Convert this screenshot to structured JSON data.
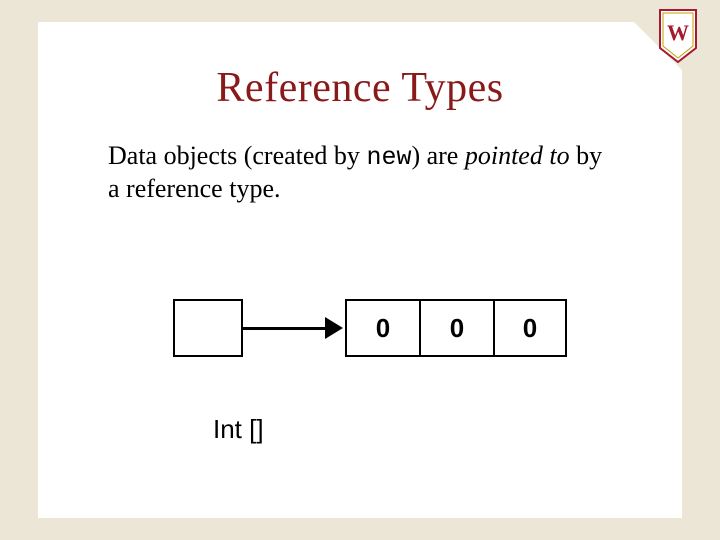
{
  "title": "Reference Types",
  "body": {
    "prefix": "Data objects (created by ",
    "keyword": "new",
    "mid": ") are ",
    "italic": "pointed to",
    "suffix": " by a reference type."
  },
  "array": {
    "cells": [
      "0",
      "0",
      "0"
    ]
  },
  "type_label": "Int []",
  "logo": {
    "letter": "W",
    "bg": "#ffffff",
    "accent": "#a6192e",
    "gold": "#c5a000"
  }
}
